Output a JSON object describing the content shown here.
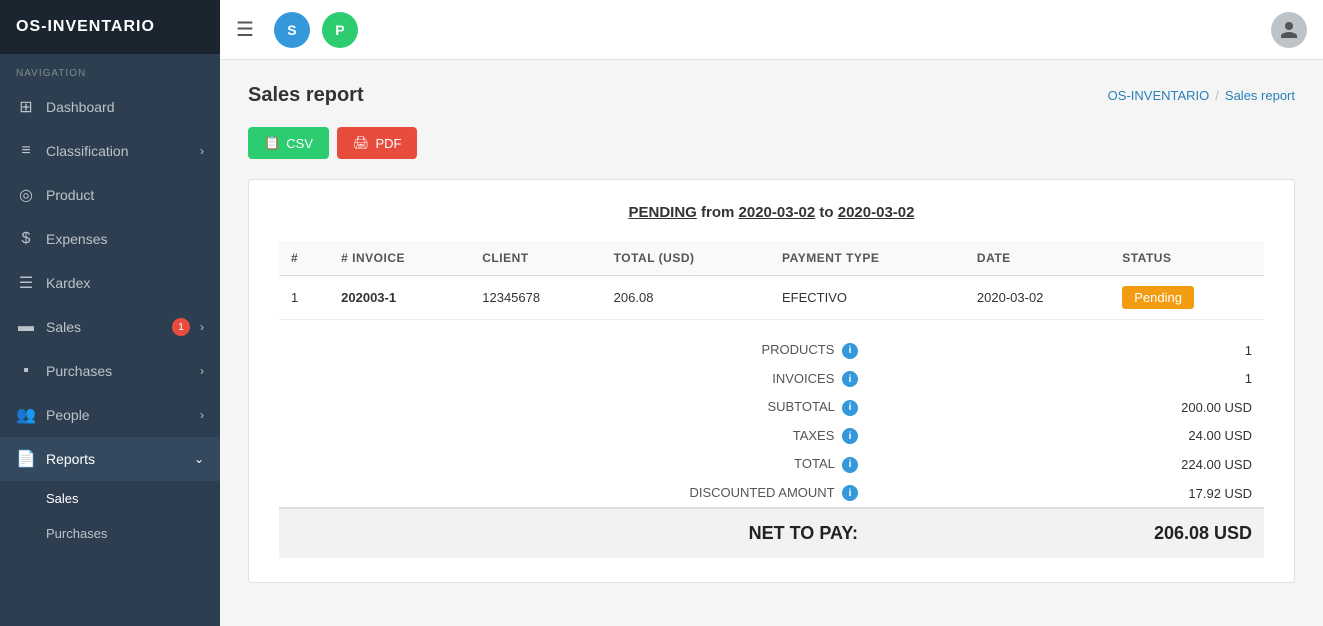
{
  "app": {
    "title": "OS-INVENTARIO"
  },
  "topbar": {
    "menu_icon": "☰",
    "avatar_s_label": "S",
    "avatar_p_label": "P"
  },
  "sidebar": {
    "nav_label": "NAVIGATION",
    "items": [
      {
        "id": "dashboard",
        "label": "Dashboard",
        "icon": "⊞",
        "has_arrow": false,
        "badge": null
      },
      {
        "id": "classification",
        "label": "Classification",
        "icon": "≡",
        "has_arrow": true,
        "badge": null
      },
      {
        "id": "product",
        "label": "Product",
        "icon": "◎",
        "has_arrow": false,
        "badge": null
      },
      {
        "id": "expenses",
        "label": "Expenses",
        "icon": "$",
        "has_arrow": false,
        "badge": null
      },
      {
        "id": "kardex",
        "label": "Kardex",
        "icon": "☰",
        "has_arrow": false,
        "badge": null
      },
      {
        "id": "sales",
        "label": "Sales",
        "icon": "▬",
        "has_arrow": true,
        "badge": "1"
      },
      {
        "id": "purchases",
        "label": "Purchases",
        "icon": "▪",
        "has_arrow": true,
        "badge": null
      },
      {
        "id": "people",
        "label": "People",
        "icon": "👥",
        "has_arrow": true,
        "badge": null
      },
      {
        "id": "reports",
        "label": "Reports",
        "icon": "📄",
        "has_arrow": true,
        "badge": null,
        "active": true
      }
    ],
    "reports_sub": [
      {
        "id": "sales-sub",
        "label": "Sales",
        "active": true
      },
      {
        "id": "purchases-sub",
        "label": "Purchases",
        "active": false
      }
    ]
  },
  "breadcrumb": {
    "home": "OS-INVENTARIO",
    "separator": "/",
    "current": "Sales report"
  },
  "page": {
    "title": "Sales report"
  },
  "toolbar": {
    "csv_label": "CSV",
    "pdf_label": "PDF"
  },
  "report": {
    "heading_pending": "PENDING",
    "heading_from": "from",
    "heading_date_start": "2020-03-02",
    "heading_to": "to",
    "heading_date_end": "2020-03-02",
    "table_headers": [
      "#",
      "# INVOICE",
      "CLIENT",
      "TOTAL (USD)",
      "PAYMENT TYPE",
      "DATE",
      "STATUS"
    ],
    "table_rows": [
      {
        "num": "1",
        "invoice": "202003-1",
        "client": "12345678",
        "total": "206.08",
        "payment_type": "EFECTIVO",
        "date": "2020-03-02",
        "status": "Pending"
      }
    ],
    "summary": [
      {
        "label": "PRODUCTS",
        "value": "1",
        "has_info": true
      },
      {
        "label": "INVOICES",
        "value": "1",
        "has_info": true
      },
      {
        "label": "SUBTOTAL",
        "value": "200.00 USD",
        "has_info": true
      },
      {
        "label": "TAXES",
        "value": "24.00 USD",
        "has_info": true
      },
      {
        "label": "TOTAL",
        "value": "224.00 USD",
        "has_info": true
      },
      {
        "label": "DISCOUNTED AMOUNT",
        "value": "17.92 USD",
        "has_info": true
      }
    ],
    "net_to_pay_label": "NET TO PAY:",
    "net_to_pay_value": "206.08 USD"
  }
}
